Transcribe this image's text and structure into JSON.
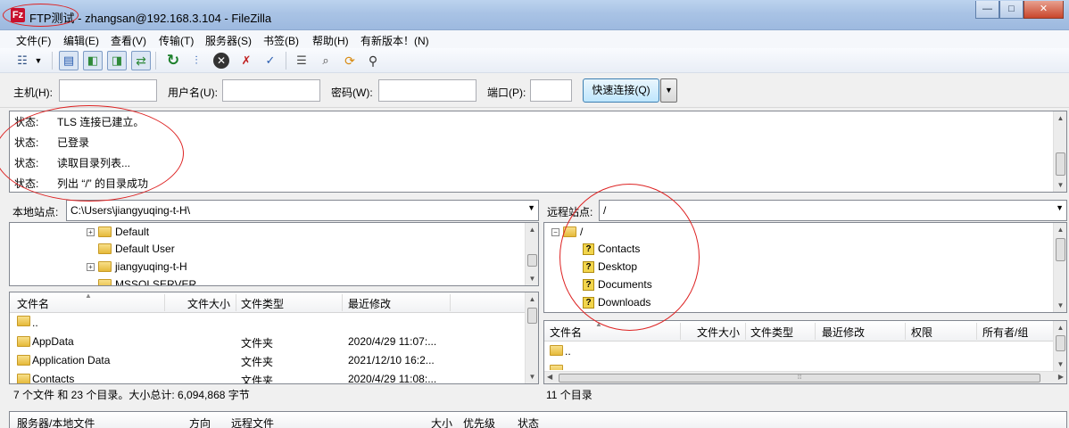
{
  "window": {
    "title": "FTP测试 - zhangsan@192.168.3.104 - FileZilla",
    "app_icon": "filezilla-icon",
    "controls": {
      "min": "—",
      "max": "□",
      "close": "✕"
    }
  },
  "menu": [
    "文件(F)",
    "编辑(E)",
    "查看(V)",
    "传输(T)",
    "服务器(S)",
    "书签(B)",
    "帮助(H)",
    "有新版本！(N)"
  ],
  "toolbar_icons": [
    "site-manager-icon",
    "dropdown-arrow-icon",
    "toggle-log-icon",
    "toggle-local-tree-icon",
    "toggle-remote-tree-icon",
    "transfer-queue-icon",
    "refresh-icon",
    "process-queue-icon",
    "cancel-icon",
    "disconnect-icon",
    "reconnect-icon",
    "filter-icon",
    "compare-icon",
    "sync-browse-icon",
    "search-icon"
  ],
  "quickconnect": {
    "host_label": "主机(H):",
    "user_label": "用户名(U):",
    "pass_label": "密码(W):",
    "port_label": "端口(P):",
    "host_value": "",
    "user_value": "",
    "pass_value": "",
    "port_value": "",
    "connect_button": "快速连接(Q)",
    "dropdown": "▼"
  },
  "log": [
    {
      "k": "状态:",
      "v": "TLS 连接已建立。"
    },
    {
      "k": "状态:",
      "v": "已登录"
    },
    {
      "k": "状态:",
      "v": "读取目录列表..."
    },
    {
      "k": "状态:",
      "v": "列出 “/” 的目录成功"
    }
  ],
  "local": {
    "site_label": "本地站点:",
    "path": "C:\\Users\\jiangyuqing-t-H\\",
    "tree": [
      "Default",
      "Default User",
      "jiangyuqing-t-H",
      "MSSQLSERVER"
    ],
    "columns": [
      "文件名",
      "文件大小",
      "文件类型",
      "最近修改"
    ],
    "rows": [
      {
        "name": "..",
        "size": "",
        "type": "",
        "modified": ""
      },
      {
        "name": "AppData",
        "size": "",
        "type": "文件夹",
        "modified": "2020/4/29 11:07:..."
      },
      {
        "name": "Application Data",
        "size": "",
        "type": "文件夹",
        "modified": "2021/12/10 16:2..."
      },
      {
        "name": "Contacts",
        "size": "",
        "type": "文件夹",
        "modified": "2020/4/29 11:08:..."
      }
    ],
    "status": "7 个文件 和 23 个目录。大小总计: 6,094,868 字节"
  },
  "remote": {
    "site_label": "远程站点:",
    "path": "/",
    "tree_root": "/",
    "tree": [
      "Contacts",
      "Desktop",
      "Documents",
      "Downloads"
    ],
    "columns": [
      "文件名",
      "文件大小",
      "文件类型",
      "最近修改",
      "权限",
      "所有者/组"
    ],
    "rows": [
      {
        "name": "..",
        "size": "",
        "type": "",
        "modified": ""
      }
    ],
    "status": "11 个目录"
  },
  "queue_columns": [
    "服务器/本地文件",
    "方向",
    "远程文件",
    "大小",
    "优先级",
    "状态"
  ]
}
